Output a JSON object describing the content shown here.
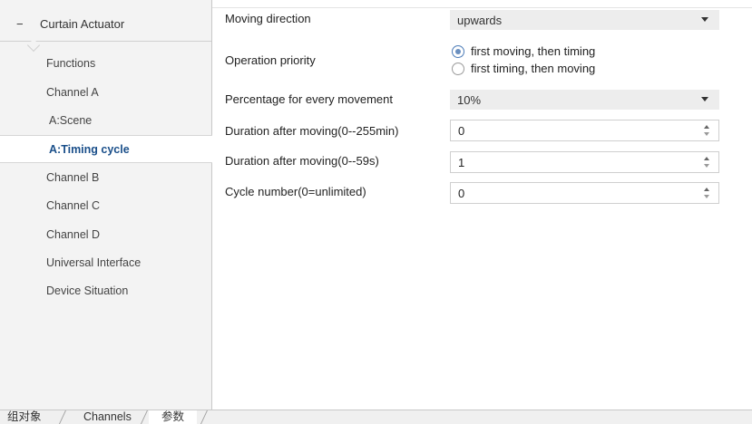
{
  "sidebar": {
    "root": {
      "collapse_symbol": "−",
      "label": "Curtain Actuator"
    },
    "items": [
      {
        "label": "Functions"
      },
      {
        "label": "Channel A"
      },
      {
        "label": "A:Scene"
      },
      {
        "label": "A:Timing cycle",
        "active": true
      },
      {
        "label": "Channel B"
      },
      {
        "label": "Channel C"
      },
      {
        "label": "Channel D"
      },
      {
        "label": "Universal Interface"
      },
      {
        "label": "Device Situation"
      }
    ]
  },
  "params": {
    "moving_direction": {
      "label": "Moving direction",
      "value": "upwards"
    },
    "operation_priority": {
      "label": "Operation priority",
      "options": [
        "first moving, then timing",
        "first timing, then moving"
      ],
      "selected": 0
    },
    "percentage": {
      "label": "Percentage for every movement",
      "value": "10%"
    },
    "duration_min": {
      "label": "Duration after moving(0--255min)",
      "value": "0"
    },
    "duration_sec": {
      "label": "Duration after moving(0--59s)",
      "value": "1"
    },
    "cycle_number": {
      "label": "Cycle number(0=unlimited)",
      "value": "0"
    }
  },
  "tabs": [
    {
      "label": "组对象"
    },
    {
      "label": "Channels"
    },
    {
      "label": "参数",
      "active": true
    }
  ],
  "colors": {
    "active_nav_text": "#1a4f8a",
    "sidebar_bg": "#f3f3f3",
    "field_bg": "#ededed"
  }
}
